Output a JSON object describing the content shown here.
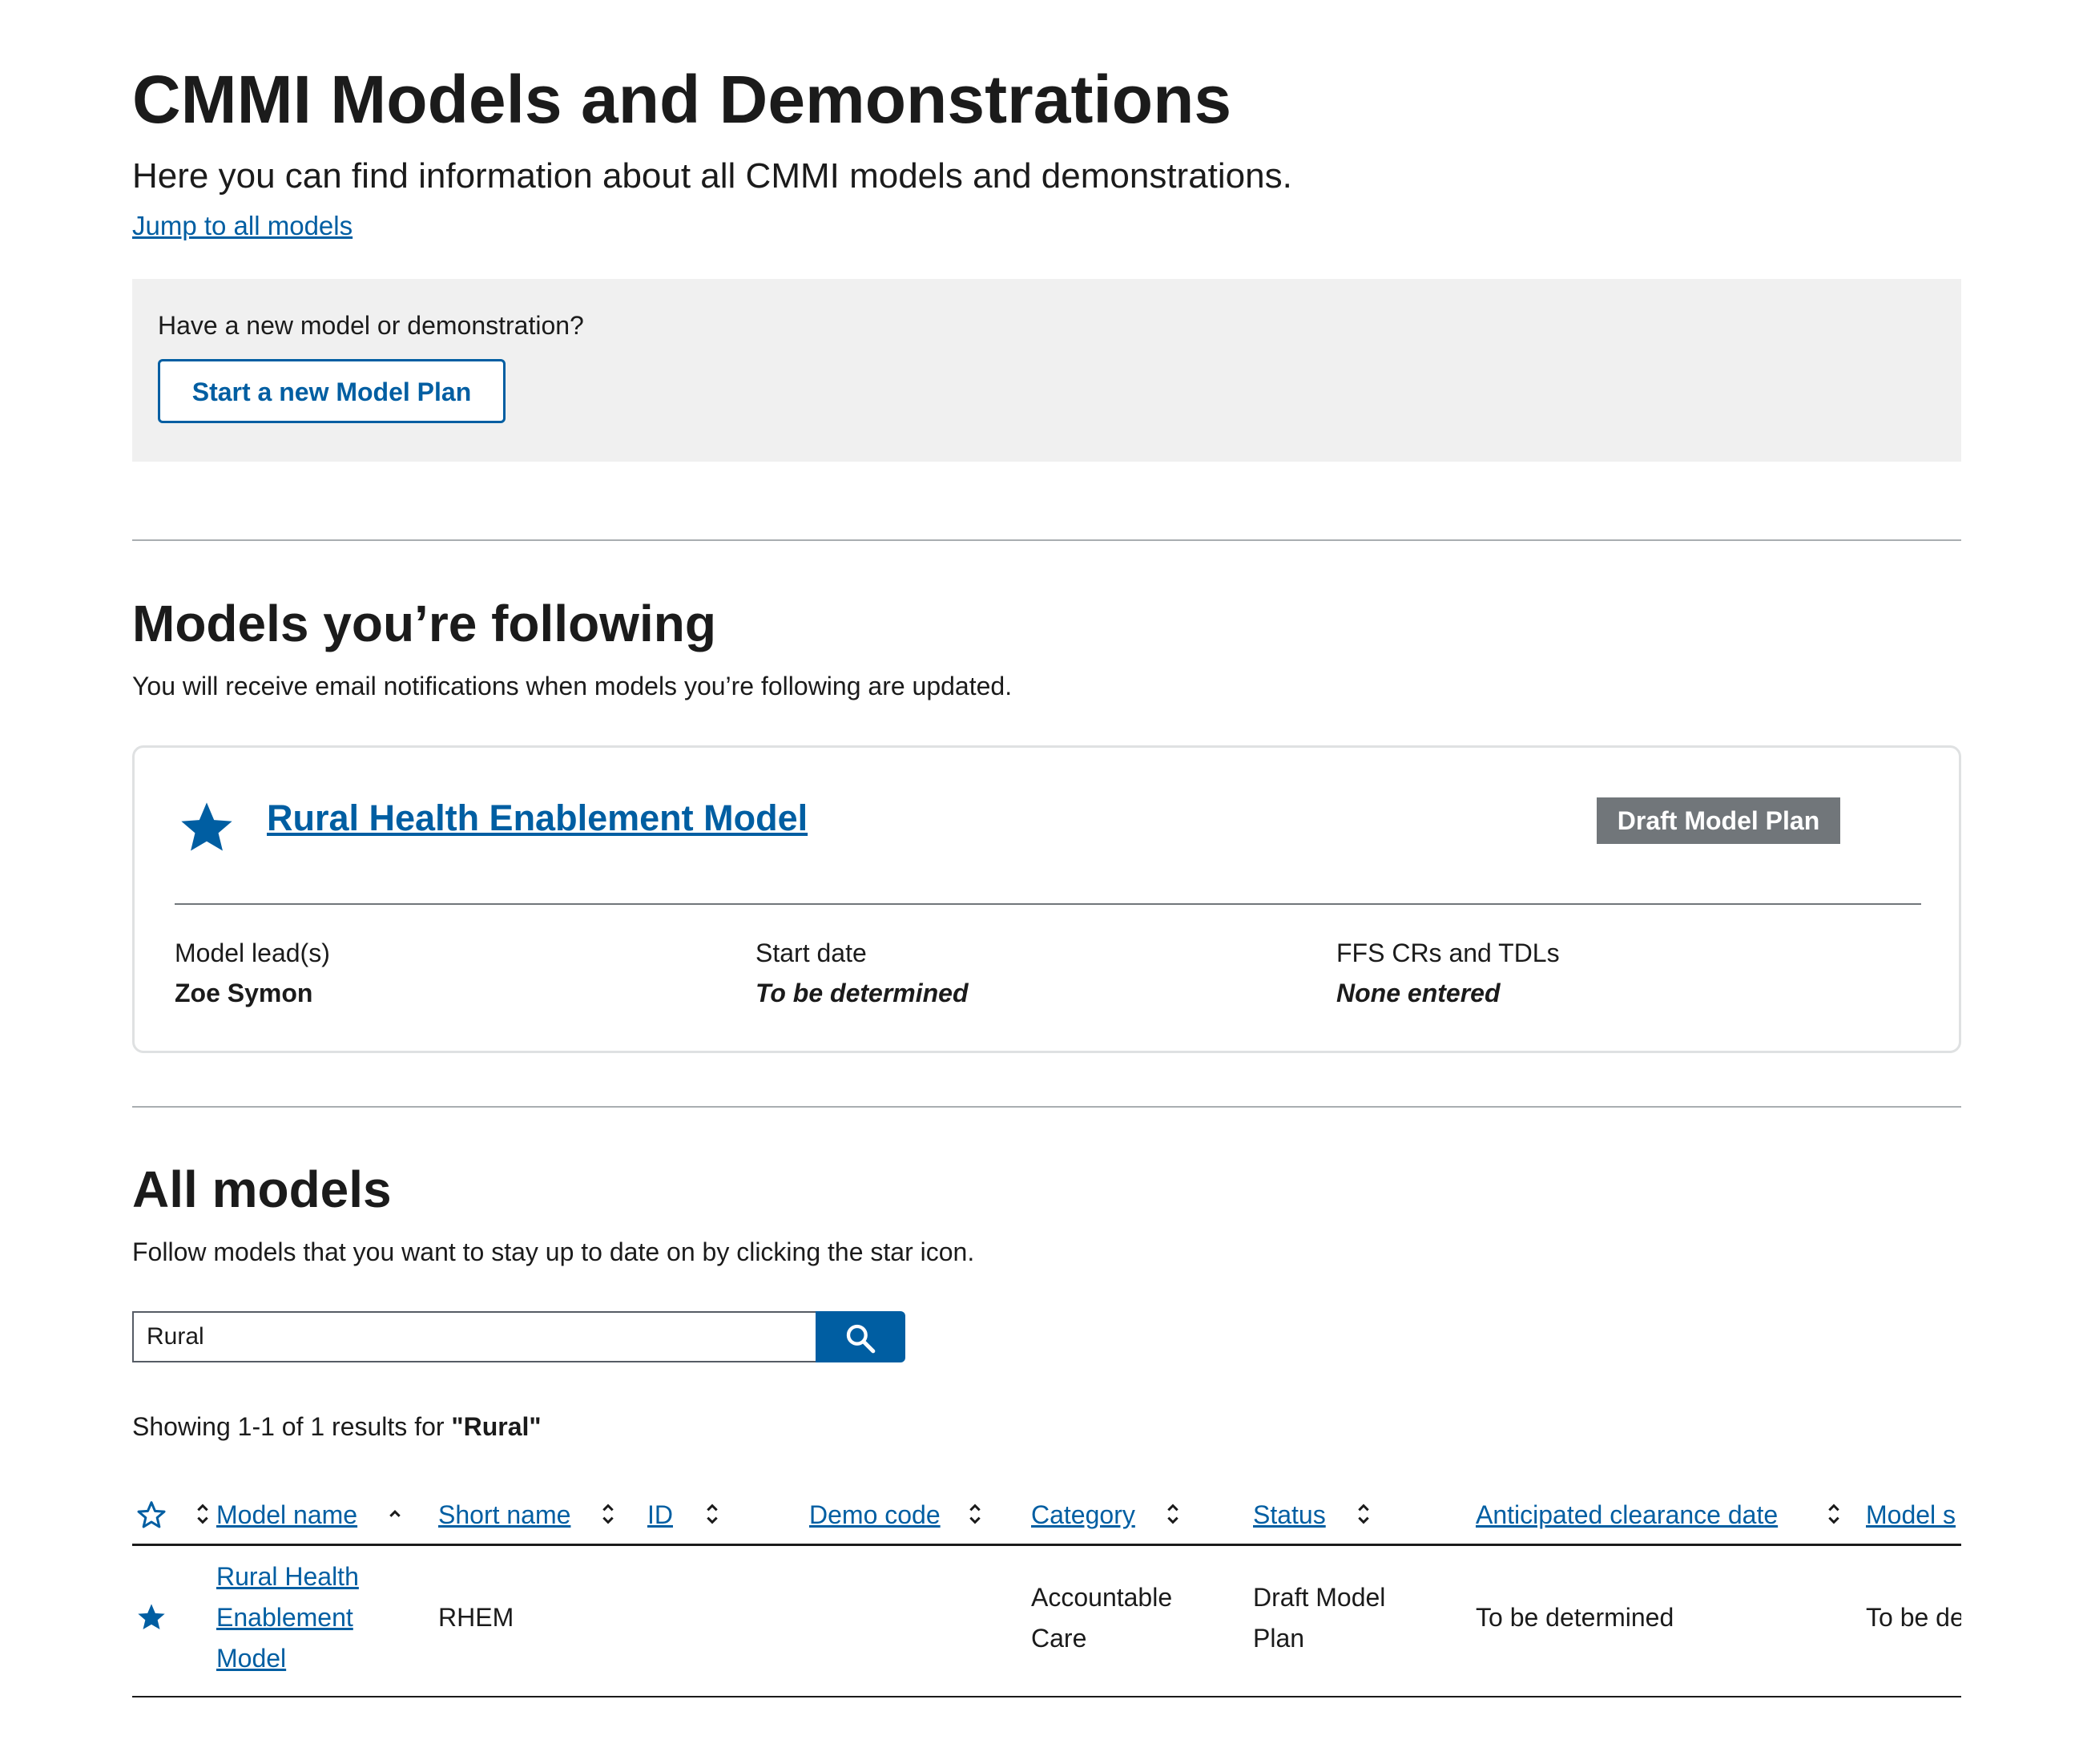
{
  "page": {
    "title": "CMMI Models and Demonstrations",
    "lead": "Here you can find information about all CMMI models and demonstrations.",
    "jump_link": "Jump to all models"
  },
  "new_model": {
    "prompt": "Have a new model or demonstration?",
    "button_label": "Start a new Model Plan"
  },
  "following": {
    "heading": "Models you’re following",
    "description": "You will receive email notifications when models you’re following are updated.",
    "card": {
      "model_name": "Rural Health Enablement Model",
      "status": "Draft Model Plan",
      "fields": [
        {
          "label": "Model lead(s)",
          "value": "Zoe Symon"
        },
        {
          "label": "Start date",
          "value": "To be determined"
        },
        {
          "label": "FFS CRs and TDLs",
          "value": "None entered"
        }
      ]
    }
  },
  "all_models": {
    "heading": "All models",
    "description": "Follow models that you want to stay up to date on by clicking the star icon.",
    "search": {
      "value": "Rural",
      "button_icon": "search-icon"
    },
    "results": {
      "prefix": "Showing 1-1 of 1 results for ",
      "query": "\"Rural\""
    },
    "table": {
      "columns": [
        "Model name",
        "Short name",
        "ID",
        "Demo code",
        "Category",
        "Status",
        "Anticipated clearance date",
        "Model s"
      ],
      "rows": [
        {
          "followed": true,
          "model_name": "Rural Health Enablement Model",
          "short_name": "RHEM",
          "id": "",
          "demo_code": "",
          "category": "Accountable Care",
          "status": "Draft Model Plan",
          "clearance_date": "To be determined",
          "model_start": "To be de"
        }
      ]
    }
  },
  "colors": {
    "link": "#005ea2",
    "text": "#1b1b1b",
    "panel_bg": "#f0f0f0",
    "status_tag": "#71767a",
    "border": "#dfe1e2"
  }
}
